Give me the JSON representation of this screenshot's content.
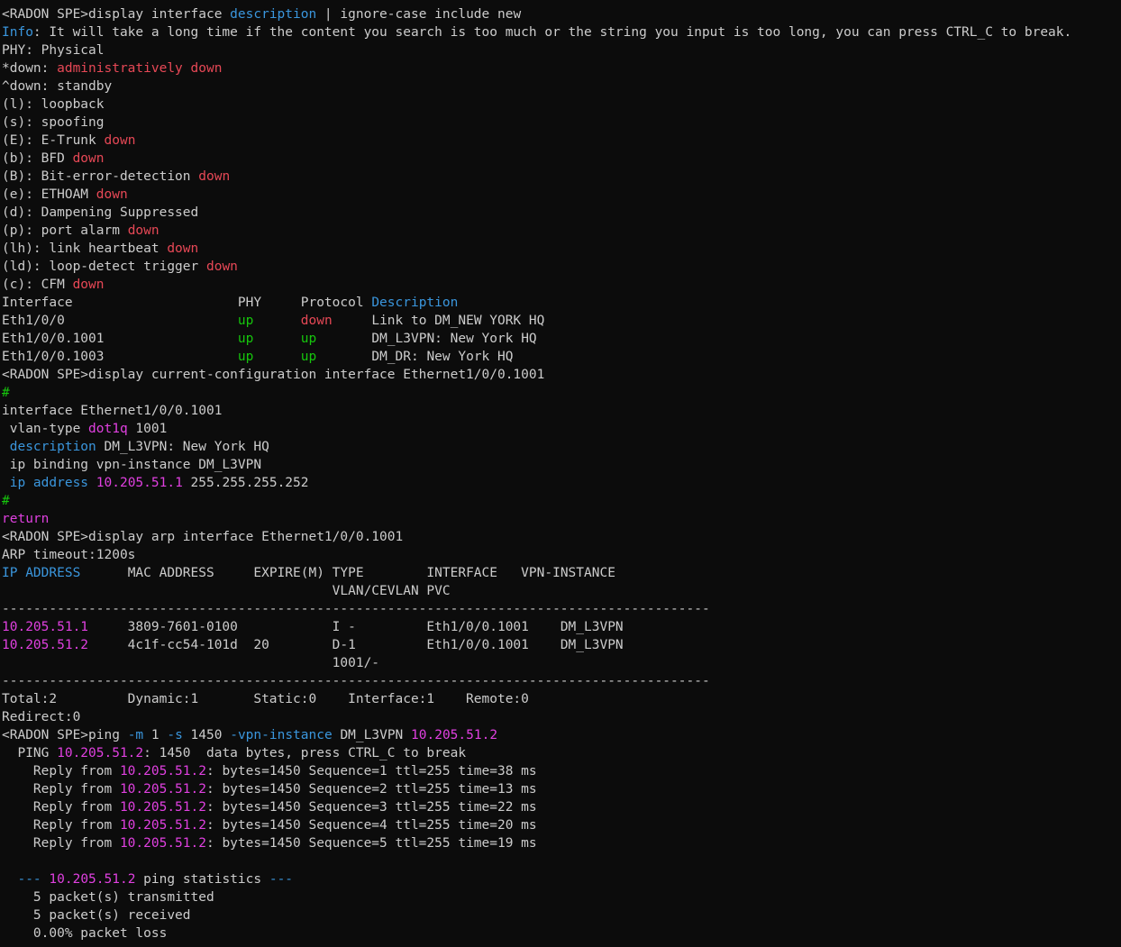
{
  "colors": {
    "background": "#0c0c0c",
    "default": "#cccccc",
    "blue": "#3a96dd",
    "red": "#e74856",
    "green": "#16c60c",
    "magenta": "#e040e0"
  },
  "lines": [
    [
      [
        "w",
        "<RADON SPE>display interface "
      ],
      [
        "b",
        "description"
      ],
      [
        "w",
        " | ignore-case include new"
      ]
    ],
    [
      [
        "b",
        "Info"
      ],
      [
        "w",
        ": It will take a long time if the content you search is too much or the string you input is too long, you can press CTRL_C to break."
      ]
    ],
    [
      [
        "w",
        "PHY: Physical"
      ]
    ],
    [
      [
        "w",
        "*down: "
      ],
      [
        "r",
        "administratively down"
      ]
    ],
    [
      [
        "w",
        "^down: standby"
      ]
    ],
    [
      [
        "w",
        "(l): loopback"
      ]
    ],
    [
      [
        "w",
        "(s): spoofing"
      ]
    ],
    [
      [
        "w",
        "(E): E-Trunk "
      ],
      [
        "r",
        "down"
      ]
    ],
    [
      [
        "w",
        "(b): BFD "
      ],
      [
        "r",
        "down"
      ]
    ],
    [
      [
        "w",
        "(B): Bit-error-detection "
      ],
      [
        "r",
        "down"
      ]
    ],
    [
      [
        "w",
        "(e): ETHOAM "
      ],
      [
        "r",
        "down"
      ]
    ],
    [
      [
        "w",
        "(d): Dampening Suppressed"
      ]
    ],
    [
      [
        "w",
        "(p): port alarm "
      ],
      [
        "r",
        "down"
      ]
    ],
    [
      [
        "w",
        "(lh): link heartbeat "
      ],
      [
        "r",
        "down"
      ]
    ],
    [
      [
        "w",
        "(ld): loop-detect trigger "
      ],
      [
        "r",
        "down"
      ]
    ],
    [
      [
        "w",
        "(c): CFM "
      ],
      [
        "r",
        "down"
      ]
    ],
    [
      [
        "w",
        "Interface                     PHY     Protocol "
      ],
      [
        "b",
        "Description"
      ]
    ],
    [
      [
        "w",
        "Eth1/0/0                      "
      ],
      [
        "g",
        "up"
      ],
      [
        "w",
        "      "
      ],
      [
        "r",
        "down"
      ],
      [
        "w",
        "     Link to DM_NEW YORK HQ"
      ]
    ],
    [
      [
        "w",
        "Eth1/0/0.1001                 "
      ],
      [
        "g",
        "up"
      ],
      [
        "w",
        "      "
      ],
      [
        "g",
        "up"
      ],
      [
        "w",
        "       DM_L3VPN: New York HQ"
      ]
    ],
    [
      [
        "w",
        "Eth1/0/0.1003                 "
      ],
      [
        "g",
        "up"
      ],
      [
        "w",
        "      "
      ],
      [
        "g",
        "up"
      ],
      [
        "w",
        "       DM_DR: New York HQ"
      ]
    ],
    [
      [
        "w",
        "<RADON SPE>display current-configuration interface Ethernet1/0/0.1001"
      ]
    ],
    [
      [
        "g",
        "#"
      ]
    ],
    [
      [
        "w",
        "interface Ethernet1/0/0.1001"
      ]
    ],
    [
      [
        "w",
        " vlan-type "
      ],
      [
        "m",
        "dot1q"
      ],
      [
        "w",
        " 1001"
      ]
    ],
    [
      [
        "w",
        " "
      ],
      [
        "b",
        "description"
      ],
      [
        "w",
        " DM_L3VPN: New York HQ"
      ]
    ],
    [
      [
        "w",
        " ip binding vpn-instance DM_L3VPN"
      ]
    ],
    [
      [
        "w",
        " "
      ],
      [
        "b",
        "ip address"
      ],
      [
        "w",
        " "
      ],
      [
        "m",
        "10.205.51.1"
      ],
      [
        "w",
        " 255.255.255.252"
      ]
    ],
    [
      [
        "g",
        "#"
      ]
    ],
    [
      [
        "m",
        "return"
      ]
    ],
    [
      [
        "w",
        "<RADON SPE>display arp interface Ethernet1/0/0.1001"
      ]
    ],
    [
      [
        "w",
        "ARP timeout:1200s"
      ]
    ],
    [
      [
        "b",
        "IP ADDRESS"
      ],
      [
        "w",
        "      MAC ADDRESS     EXPIRE(M) TYPE        INTERFACE   VPN-INSTANCE"
      ]
    ],
    [
      [
        "w",
        "                                          VLAN/CEVLAN PVC"
      ]
    ],
    [
      [
        "w",
        "------------------------------------------------------------------------------------------"
      ]
    ],
    [
      [
        "m",
        "10.205.51.1"
      ],
      [
        "w",
        "     3809-7601-0100            I -         Eth1/0/0.1001    DM_L3VPN"
      ]
    ],
    [
      [
        "m",
        "10.205.51.2"
      ],
      [
        "w",
        "     4c1f-cc54-101d  20        D-1         Eth1/0/0.1001    DM_L3VPN"
      ]
    ],
    [
      [
        "w",
        "                                          1001/-"
      ]
    ],
    [
      [
        "w",
        "------------------------------------------------------------------------------------------"
      ]
    ],
    [
      [
        "w",
        "Total:2         Dynamic:1       Static:0    Interface:1    Remote:0"
      ]
    ],
    [
      [
        "w",
        "Redirect:0"
      ]
    ],
    [
      [
        "w",
        "<RADON SPE>ping "
      ],
      [
        "b",
        "-m"
      ],
      [
        "w",
        " 1 "
      ],
      [
        "b",
        "-s"
      ],
      [
        "w",
        " 1450 "
      ],
      [
        "b",
        "-vpn-instance"
      ],
      [
        "w",
        " DM_L3VPN "
      ],
      [
        "m",
        "10.205.51.2"
      ]
    ],
    [
      [
        "w",
        "  PING "
      ],
      [
        "m",
        "10.205.51.2"
      ],
      [
        "w",
        ": 1450  data bytes, press CTRL_C to break"
      ]
    ],
    [
      [
        "w",
        "    Reply from "
      ],
      [
        "m",
        "10.205.51.2"
      ],
      [
        "w",
        ": bytes=1450 Sequence=1 ttl=255 time=38 ms"
      ]
    ],
    [
      [
        "w",
        "    Reply from "
      ],
      [
        "m",
        "10.205.51.2"
      ],
      [
        "w",
        ": bytes=1450 Sequence=2 ttl=255 time=13 ms"
      ]
    ],
    [
      [
        "w",
        "    Reply from "
      ],
      [
        "m",
        "10.205.51.2"
      ],
      [
        "w",
        ": bytes=1450 Sequence=3 ttl=255 time=22 ms"
      ]
    ],
    [
      [
        "w",
        "    Reply from "
      ],
      [
        "m",
        "10.205.51.2"
      ],
      [
        "w",
        ": bytes=1450 Sequence=4 ttl=255 time=20 ms"
      ]
    ],
    [
      [
        "w",
        "    Reply from "
      ],
      [
        "m",
        "10.205.51.2"
      ],
      [
        "w",
        ": bytes=1450 Sequence=5 ttl=255 time=19 ms"
      ]
    ],
    [
      [
        "w",
        ""
      ]
    ],
    [
      [
        "w",
        "  "
      ],
      [
        "b",
        "---"
      ],
      [
        "w",
        " "
      ],
      [
        "m",
        "10.205.51.2"
      ],
      [
        "w",
        " ping statistics "
      ],
      [
        "b",
        "---"
      ]
    ],
    [
      [
        "w",
        "    5 packet(s) transmitted"
      ]
    ],
    [
      [
        "w",
        "    5 packet(s) received"
      ]
    ],
    [
      [
        "w",
        "    0.00% packet loss"
      ]
    ]
  ]
}
